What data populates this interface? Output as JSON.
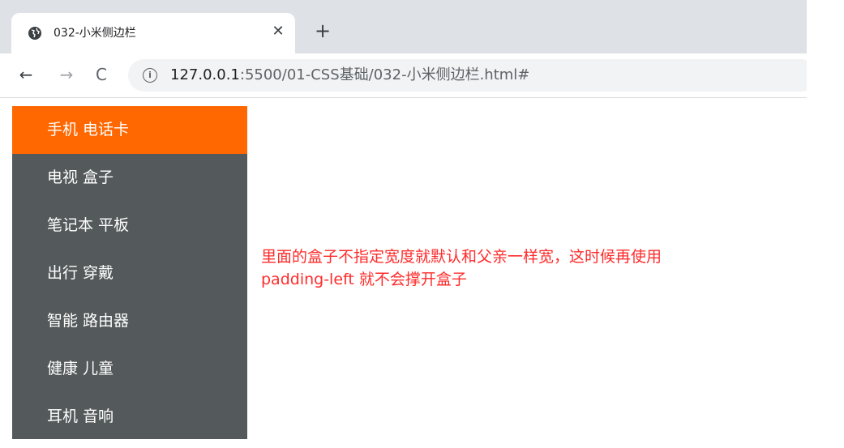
{
  "browser": {
    "tab": {
      "title": "032-小米侧边栏",
      "close_glyph": "✕"
    },
    "new_tab_glyph": "+",
    "toolbar": {
      "back_glyph": "←",
      "forward_glyph": "→",
      "reload_glyph": "C",
      "info_glyph": "i",
      "url_host": "127.0.0.1",
      "url_path": ":5500/01-CSS基础/032-小米侧边栏.html#"
    }
  },
  "sidebar": {
    "items": [
      {
        "label": "手机 电话卡",
        "active": true
      },
      {
        "label": "电视 盒子",
        "active": false
      },
      {
        "label": "笔记本 平板",
        "active": false
      },
      {
        "label": "出行 穿戴",
        "active": false
      },
      {
        "label": "智能 路由器",
        "active": false
      },
      {
        "label": "健康 儿童",
        "active": false
      },
      {
        "label": "耳机 音响",
        "active": false
      }
    ]
  },
  "note": {
    "line1": "里面的盒子不指定宽度就默认和父亲一样宽，这时候再使用",
    "line2": "padding-left 就不会撑开盒子"
  },
  "colors": {
    "active_item": "#ff6700",
    "sidebar_bg": "#54595b",
    "note_text": "#ff2b2b"
  }
}
